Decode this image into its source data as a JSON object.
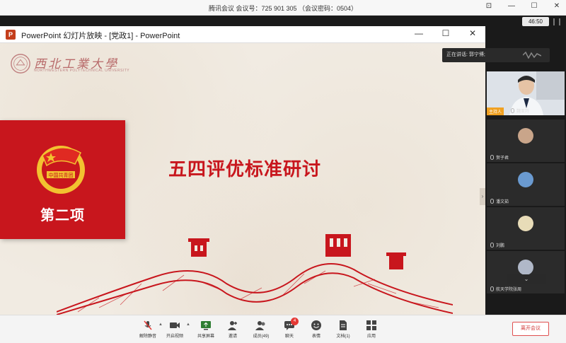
{
  "app": {
    "title": "腾讯会议 会议号：725 901 305  （会议密码：0504）",
    "timer": "46:50"
  },
  "ppt": {
    "window_title": "PowerPoint 幻灯片放映 - [党政1] - PowerPoint",
    "logo_letter": "P"
  },
  "slide": {
    "university_name": "西北工業大學",
    "university_en": "NORTHWESTERN POLYTECHNICAL UNIVERSITY",
    "section_label": "第二项",
    "badge_text": "中国共青团",
    "title": "五四评优标准研讨"
  },
  "speaking": {
    "label": "正在讲话: 郭宁博;"
  },
  "participants": [
    {
      "name": "魏亚羚",
      "host_tag": "主持人"
    },
    {
      "name": "贺子君",
      "avatar_color": "#c9a58a"
    },
    {
      "name": "潘文茹",
      "avatar_color": "#6a9ad0"
    },
    {
      "name": "刘鹏",
      "avatar_color": "#e8dcb8"
    },
    {
      "name": "航天学院张周",
      "avatar_color": "#b0b8c8"
    }
  ],
  "toolbar": {
    "mute": "解除静音",
    "video": "开启视频",
    "share": "共享屏幕",
    "invite": "邀请",
    "members": "成员(49)",
    "chat": "聊天",
    "chat_badge": "4",
    "reaction": "表情",
    "docs": "文档(1)",
    "apps": "应用",
    "leave": "离开会议"
  },
  "colors": {
    "slide_red": "#c8161d",
    "slide_bg": "#f1ebe2",
    "host_tag": "#f0a020",
    "leave_red": "#d23a3a"
  }
}
